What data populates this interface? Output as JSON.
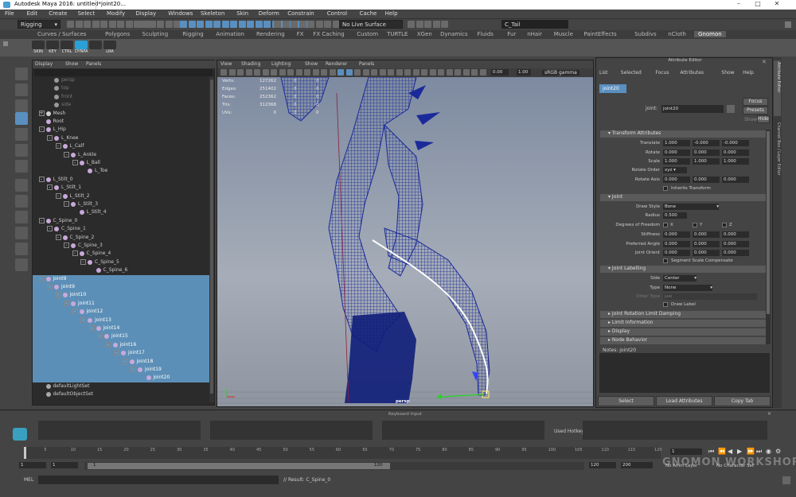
{
  "window": {
    "title": "Autodesk Maya 2016: untitled*",
    "tab": "joint20..."
  },
  "menus": [
    "File",
    "Edit",
    "Create",
    "Select",
    "Modify",
    "Display",
    "Windows",
    "Skeleton",
    "Skin",
    "Deform",
    "Constrain",
    "Control",
    "Cache",
    "Help"
  ],
  "status": {
    "mode": "Rigging",
    "live_surface": "No Live Surface",
    "search_value": "C_Tail"
  },
  "shelf": {
    "tabs": [
      "Curves / Surfaces",
      "Polygons",
      "Sculpting",
      "Rigging",
      "Animation",
      "Rendering",
      "FX",
      "FX Caching",
      "Custom",
      "TURTLE",
      "XGen",
      "Dynamics",
      "Fluids",
      "Fur",
      "nHair",
      "Muscle",
      "PaintEffects",
      "Subdivs",
      "nCloth",
      "Gnomon"
    ],
    "active_tab": "Gnomon",
    "buttons": [
      "SKIN",
      "KEY",
      "CTRL",
      "DYNPA",
      "",
      "LRA"
    ]
  },
  "outliner": {
    "menus": [
      "Display",
      "Show",
      "Panels"
    ],
    "rows": [
      {
        "name": "persp",
        "depth": 2,
        "icon": "camera",
        "selected": false,
        "dim": true
      },
      {
        "name": "top",
        "depth": 2,
        "icon": "camera",
        "selected": false,
        "dim": true
      },
      {
        "name": "front",
        "depth": 2,
        "icon": "camera",
        "selected": false,
        "dim": true
      },
      {
        "name": "side",
        "depth": 2,
        "icon": "camera",
        "selected": false,
        "dim": true
      },
      {
        "name": "Mesh",
        "depth": 1,
        "icon": "mesh",
        "expander": "+",
        "selected": false
      },
      {
        "name": "Root",
        "depth": 1,
        "icon": "joint",
        "selected": false
      },
      {
        "name": "L_Hip",
        "depth": 1,
        "icon": "joint",
        "expander": "-",
        "selected": false
      },
      {
        "name": "L_Knee",
        "depth": 2,
        "icon": "joint",
        "expander": "-",
        "selected": false
      },
      {
        "name": "L_Calf",
        "depth": 3,
        "icon": "joint",
        "expander": "-",
        "selected": false
      },
      {
        "name": "L_Ankle",
        "depth": 4,
        "icon": "joint",
        "expander": "-",
        "selected": false
      },
      {
        "name": "L_Ball",
        "depth": 5,
        "icon": "joint",
        "expander": "-",
        "selected": false
      },
      {
        "name": "L_Toe",
        "depth": 6,
        "icon": "joint",
        "selected": false
      },
      {
        "name": "L_Stilt_0",
        "depth": 1,
        "icon": "joint",
        "expander": "-",
        "selected": false
      },
      {
        "name": "L_Stilt_1",
        "depth": 2,
        "icon": "joint",
        "expander": "-",
        "selected": false
      },
      {
        "name": "L_Stilt_2",
        "depth": 3,
        "icon": "joint",
        "expander": "-",
        "selected": false
      },
      {
        "name": "L_Stilt_3",
        "depth": 4,
        "icon": "joint",
        "expander": "-",
        "selected": false
      },
      {
        "name": "L_Stilt_4",
        "depth": 5,
        "icon": "joint",
        "selected": false
      },
      {
        "name": "C_Spine_0",
        "depth": 1,
        "icon": "joint",
        "expander": "-",
        "selected": false
      },
      {
        "name": "C_Spine_1",
        "depth": 2,
        "icon": "joint",
        "expander": "-",
        "selected": false
      },
      {
        "name": "C_Spine_2",
        "depth": 3,
        "icon": "joint",
        "expander": "-",
        "selected": false
      },
      {
        "name": "C_Spine_3",
        "depth": 4,
        "icon": "joint",
        "expander": "-",
        "selected": false
      },
      {
        "name": "C_Spine_4",
        "depth": 5,
        "icon": "joint",
        "expander": "-",
        "selected": false
      },
      {
        "name": "C_Spine_5",
        "depth": 6,
        "icon": "joint",
        "expander": "-",
        "selected": false
      },
      {
        "name": "C_Spine_6",
        "depth": 7,
        "icon": "joint",
        "selected": false
      },
      {
        "name": "joint9",
        "depth": 1,
        "icon": "joint",
        "expander": "-",
        "selected": true
      },
      {
        "name": "joint9",
        "depth": 2,
        "icon": "joint",
        "expander": "-",
        "selected": true
      },
      {
        "name": "joint10",
        "depth": 3,
        "icon": "joint",
        "expander": "-",
        "selected": true
      },
      {
        "name": "joint11",
        "depth": 4,
        "icon": "joint",
        "expander": "-",
        "selected": true
      },
      {
        "name": "joint12",
        "depth": 5,
        "icon": "joint",
        "expander": "-",
        "selected": true
      },
      {
        "name": "joint13",
        "depth": 6,
        "icon": "joint",
        "expander": "-",
        "selected": true
      },
      {
        "name": "joint14",
        "depth": 7,
        "icon": "joint",
        "expander": "-",
        "selected": true
      },
      {
        "name": "joint15",
        "depth": 8,
        "icon": "joint",
        "expander": "-",
        "selected": true
      },
      {
        "name": "joint16",
        "depth": 9,
        "icon": "joint",
        "expander": "-",
        "selected": true
      },
      {
        "name": "joint17",
        "depth": 10,
        "icon": "joint",
        "expander": "-",
        "selected": true
      },
      {
        "name": "joint18",
        "depth": 11,
        "icon": "joint",
        "expander": "-",
        "selected": true
      },
      {
        "name": "joint19",
        "depth": 12,
        "icon": "joint",
        "expander": "-",
        "selected": true
      },
      {
        "name": "joint20",
        "depth": 13,
        "icon": "joint",
        "selected": true
      },
      {
        "name": "defaultLightSet",
        "depth": 1,
        "icon": "set",
        "selected": false
      },
      {
        "name": "defaultObjectSet",
        "depth": 1,
        "icon": "set",
        "selected": false
      }
    ]
  },
  "viewport": {
    "menus": [
      "View",
      "Shading",
      "Lighting",
      "Show",
      "Renderer",
      "Panels"
    ],
    "exposure": "0.00",
    "gamma": "1.00",
    "color_space": "sRGB gamma",
    "camera_label": "persp",
    "hud": [
      {
        "label": "Verts:",
        "value": "127262",
        "a": "0",
        "b": "0"
      },
      {
        "label": "Edges:",
        "value": "251402",
        "a": "0",
        "b": "0"
      },
      {
        "label": "Faces:",
        "value": "252362",
        "a": "0",
        "b": "0"
      },
      {
        "label": "Tris:",
        "value": "312368",
        "a": "0",
        "b": "0"
      },
      {
        "label": "UVs:",
        "value": "0",
        "a": "0",
        "b": "0"
      }
    ]
  },
  "attribute_editor": {
    "title": "Attribute Editor",
    "menus": [
      "List",
      "Selected",
      "Focus",
      "Attributes",
      "Show",
      "Help"
    ],
    "node_tab": "joint20",
    "node_label": "joint:",
    "node_name": "joint20",
    "focus_button": "Focus",
    "presets_button": "Presets",
    "show_label": "Show",
    "hide_button": "Hide",
    "transform_section": "Transform Attributes",
    "transform_rows": [
      {
        "label": "Translate",
        "values": [
          "1.000",
          "-0.000",
          "-0.000"
        ]
      },
      {
        "label": "Rotate",
        "values": [
          "0.000",
          "0.000",
          "0.000"
        ]
      },
      {
        "label": "Scale",
        "values": [
          "1.000",
          "1.000",
          "1.000"
        ]
      }
    ],
    "rotate_order_label": "Rotate Order",
    "rotate_order": "xyz",
    "rotate_axis_label": "Rotate Axis",
    "rotate_axis": [
      "0.000",
      "0.000",
      "0.000"
    ],
    "inherits_transform": "Inherits Transform",
    "joint_section": "Joint",
    "draw_style_label": "Draw Style",
    "draw_style": "Bone",
    "radius_label": "Radius",
    "radius": "0.500",
    "dof_label": "Degrees of Freedom",
    "dof": [
      "X",
      "Y",
      "Z"
    ],
    "joint_rows": [
      {
        "label": "Stiffness",
        "values": [
          "0.000",
          "0.000",
          "0.000"
        ]
      },
      {
        "label": "Preferred Angle",
        "values": [
          "0.000",
          "0.000",
          "0.000"
        ]
      },
      {
        "label": "Joint Orient",
        "values": [
          "0.000",
          "0.000",
          "0.000"
        ]
      }
    ],
    "segment_scale": "Segment Scale Compensate",
    "labelling_section": "Joint Labelling",
    "side_label": "Side",
    "side": "Center",
    "type_label": "Type",
    "type": "None",
    "other_type_label": "Other Type",
    "other_type": "jaw",
    "draw_label": "Draw Label",
    "collapsed_sections": [
      "Joint Rotation Limit Damping",
      "Limit Information",
      "Display",
      "Node Behavior"
    ],
    "notes_label": "Notes: joint20",
    "footer_buttons": [
      "Select",
      "Load Attributes",
      "Copy Tab"
    ]
  },
  "right_tabs": [
    "Attribute Editor",
    "Channel Box / Layer Editor"
  ],
  "keyboard": {
    "title": "Keyboard Input",
    "used_hotkey_label": "Used Hotkey:"
  },
  "timeline": {
    "ticks": [
      5,
      10,
      15,
      20,
      25,
      30,
      35,
      40,
      45,
      50,
      55,
      60,
      65,
      70,
      75,
      80,
      85,
      90,
      95,
      100,
      105,
      110,
      115,
      120
    ],
    "current_frame": "1"
  },
  "range": {
    "start": "1",
    "start2": "1",
    "slider_start": "1",
    "slider_end": "120",
    "end": "120",
    "end2": "200",
    "anim_layer": "No Anim Layer",
    "char_set": "No Character Set"
  },
  "command": {
    "label": "MEL",
    "result": "// Result: C_Spine_0"
  },
  "watermark": "GNOMON WORKSHOP"
}
